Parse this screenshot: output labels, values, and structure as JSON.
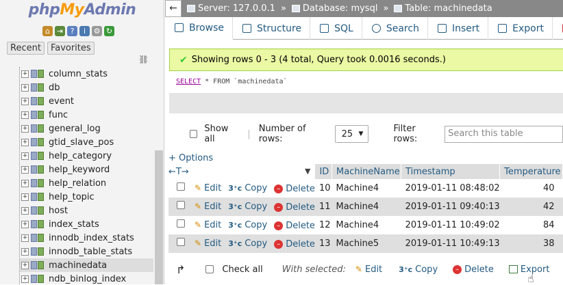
{
  "sidebar": {
    "logo_php": "php",
    "logo_my": "My",
    "logo_admin": "Admin",
    "icons": [
      "home-icon",
      "exit-icon",
      "query-icon",
      "docs-icon",
      "settings-icon",
      "reload-icon"
    ],
    "tabs": {
      "recent": "Recent",
      "favorites": "Favorites"
    },
    "tables": [
      "column_stats",
      "db",
      "event",
      "func",
      "general_log",
      "gtid_slave_pos",
      "help_category",
      "help_keyword",
      "help_relation",
      "help_topic",
      "host",
      "index_stats",
      "innodb_index_stats",
      "innodb_table_stats",
      "machinedata",
      "ndb_binlog_index"
    ],
    "selected": "machinedata"
  },
  "breadcrumb": {
    "server": "Server: 127.0.0.1",
    "database": "Database: mysql",
    "table": "Table: machinedata",
    "sep": "»"
  },
  "tabs": [
    "Browse",
    "Structure",
    "SQL",
    "Search",
    "Insert",
    "Export"
  ],
  "message": "Showing rows 0 - 3 (4 total, Query took 0.0016 seconds.)",
  "sql": {
    "select": "SELECT",
    "rest": " * FROM `machinedata`"
  },
  "controls": {
    "show_all": "Show all",
    "num_rows_label": "Number of rows:",
    "num_rows_value": "25",
    "filter_label": "Filter rows:",
    "filter_placeholder": "Search this table"
  },
  "options_link": "+ Options",
  "columns": [
    "ID",
    "MachineName",
    "Timestamp",
    "Temperature"
  ],
  "actions": {
    "edit": "Edit",
    "copy": "Copy",
    "delete": "Delete"
  },
  "rows": [
    {
      "id": "10",
      "name": "Machine4",
      "ts": "2019-01-11 08:48:02",
      "temp": "40"
    },
    {
      "id": "11",
      "name": "Machine4",
      "ts": "2019-01-11 09:40:13",
      "temp": "42"
    },
    {
      "id": "12",
      "name": "Machine4",
      "ts": "2019-01-11 10:49:02",
      "temp": "84"
    },
    {
      "id": "13",
      "name": "Machine5",
      "ts": "2019-01-11 10:49:13",
      "temp": "38"
    }
  ],
  "bottom": {
    "check_all": "Check all",
    "with_selected": "With selected:",
    "edit": "Edit",
    "copy": "Copy",
    "delete": "Delete",
    "export": "Export"
  }
}
